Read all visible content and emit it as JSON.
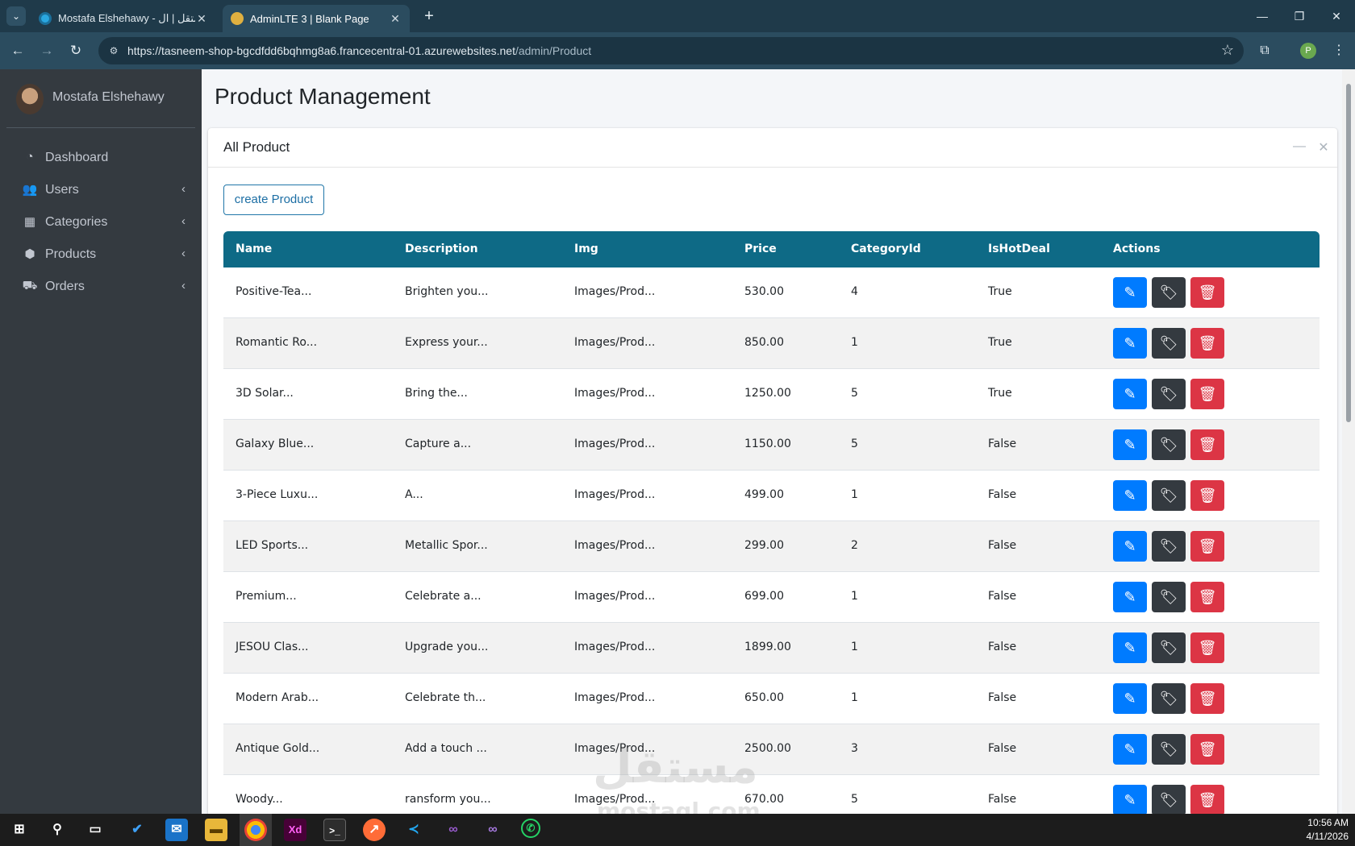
{
  "browser": {
    "tabs": [
      {
        "title": "Mostafa Elshehawy - مستقل | ال",
        "active": false
      },
      {
        "title": "AdminLTE 3 | Blank Page",
        "active": true
      }
    ],
    "url_base": "https://tasneem-shop-bgcdfdd6bqhmg8a6.francecentral-01.azurewebsites.net",
    "url_path": "/admin/Product",
    "profile_letter": "P"
  },
  "sidebar": {
    "user_name": "Mostafa Elshehawy",
    "items": [
      {
        "label": "Dashboard",
        "icon": "dashboard-icon",
        "has_arrow": false
      },
      {
        "label": "Users",
        "icon": "users-icon",
        "has_arrow": true
      },
      {
        "label": "Categories",
        "icon": "grid-icon",
        "has_arrow": true
      },
      {
        "label": "Products",
        "icon": "box-icon",
        "has_arrow": true
      },
      {
        "label": "Orders",
        "icon": "truck-icon",
        "has_arrow": true
      }
    ]
  },
  "main": {
    "page_title": "Product Management",
    "card_title": "All Product",
    "create_label": "create Product",
    "columns": [
      "Name",
      "Description",
      "Img",
      "Price",
      "CategoryId",
      "IsHotDeal",
      "Actions"
    ],
    "rows": [
      [
        "Positive-Tea...",
        "Brighten you...",
        "Images/Prod...",
        "530.00",
        "4",
        "True"
      ],
      [
        "Romantic Ro...",
        "Express your...",
        "Images/Prod...",
        "850.00",
        "1",
        "True"
      ],
      [
        "3D Solar...",
        "Bring the...",
        "Images/Prod...",
        "1250.00",
        "5",
        "True"
      ],
      [
        "Galaxy Blue...",
        "Capture a...",
        "Images/Prod...",
        "1150.00",
        "5",
        "False"
      ],
      [
        "3-Piece Luxu...",
        "A...",
        "Images/Prod...",
        "499.00",
        "1",
        "False"
      ],
      [
        "LED Sports...",
        "Metallic Spor...",
        "Images/Prod...",
        "299.00",
        "2",
        "False"
      ],
      [
        "Premium...",
        "Celebrate a...",
        "Images/Prod...",
        "699.00",
        "1",
        "False"
      ],
      [
        "JESOU Clas...",
        "Upgrade you...",
        "Images/Prod...",
        "1899.00",
        "1",
        "False"
      ],
      [
        "Modern Arab...",
        "Celebrate th...",
        "Images/Prod...",
        "650.00",
        "1",
        "False"
      ],
      [
        "Antique Gold...",
        "Add a touch ...",
        "Images/Prod...",
        "2500.00",
        "3",
        "False"
      ],
      [
        "Woody...",
        "ransform you...",
        "Images/Prod...",
        "670.00",
        "5",
        "False"
      ]
    ]
  },
  "watermark": {
    "arabic": "مستقل",
    "latin": "mostaql.com"
  },
  "taskbar": {
    "time": "10:56 AM",
    "date": "4/11/2026"
  },
  "colors": {
    "header": "#0e6a86",
    "edit": "#007bff",
    "tag": "#343a40",
    "delete": "#dc3545",
    "sidebar": "#343a40"
  }
}
